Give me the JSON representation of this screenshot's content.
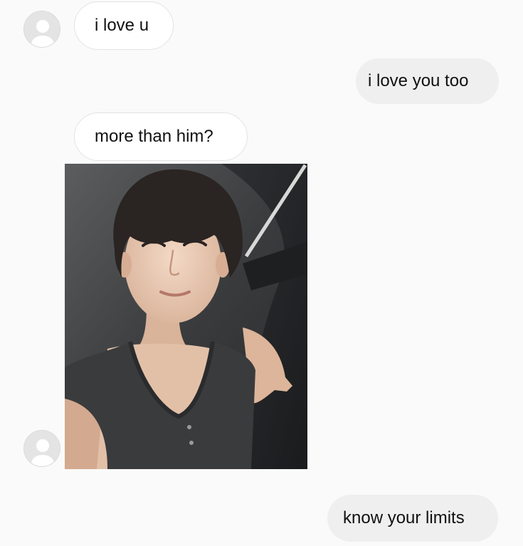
{
  "messages": [
    {
      "direction": "incoming",
      "text": "i love u"
    },
    {
      "direction": "outgoing",
      "text": "i love you too"
    },
    {
      "direction": "incoming",
      "text": "more than him?"
    },
    {
      "direction": "incoming",
      "type": "photo",
      "description_icon": "selfie-photo"
    },
    {
      "direction": "outgoing",
      "text": "know your limits"
    }
  ],
  "colors": {
    "background": "#fafafa",
    "incoming_bubble": "#ffffff",
    "incoming_border": "#e3e3e3",
    "outgoing_bubble": "#efefef",
    "text": "#111111",
    "avatar_placeholder": "#e6e6e6"
  },
  "icons": {
    "avatar": "default-avatar-icon"
  }
}
